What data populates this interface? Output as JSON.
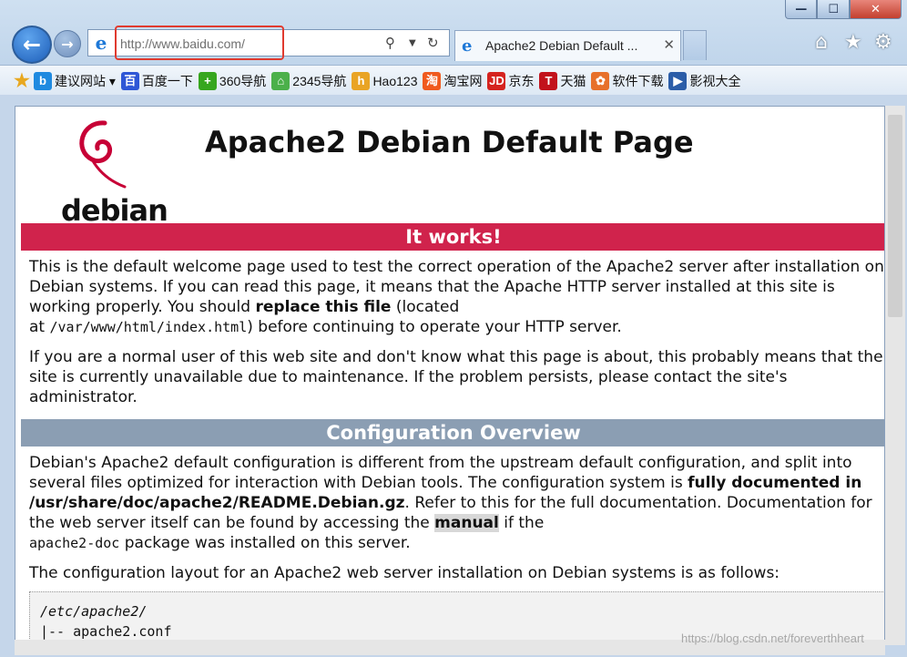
{
  "window": {
    "min": "—",
    "max": "☐",
    "close": "✕"
  },
  "nav": {
    "back": "←",
    "forward": "→"
  },
  "address": {
    "url": "http://www.baidu.com/"
  },
  "tab": {
    "title": "Apache2 Debian Default ..."
  },
  "favorites": [
    {
      "label": "建议网站 ▾",
      "icon": "bing-icon",
      "color": "#1f8ae0",
      "glyph": "b"
    },
    {
      "label": "百度一下",
      "icon": "baidu-paw-icon",
      "color": "#2f57d6",
      "glyph": "百"
    },
    {
      "label": "360导航",
      "icon": "360-icon",
      "color": "#36a61e",
      "glyph": "+"
    },
    {
      "label": "2345导航",
      "icon": "2345-house-icon",
      "color": "#4bb04a",
      "glyph": "⌂"
    },
    {
      "label": "Hao123",
      "icon": "hao123-icon",
      "color": "#e9a425",
      "glyph": "h"
    },
    {
      "label": "淘宝网",
      "icon": "taobao-icon",
      "color": "#f05a1e",
      "glyph": "淘"
    },
    {
      "label": "京东",
      "icon": "jd-icon",
      "color": "#d5231f",
      "glyph": "JD"
    },
    {
      "label": "天猫",
      "icon": "tmall-icon",
      "color": "#c2121c",
      "glyph": "T"
    },
    {
      "label": "软件下载",
      "icon": "software-download-icon",
      "color": "#e7702a",
      "glyph": "✿"
    },
    {
      "label": "影视大全",
      "icon": "video-icon",
      "color": "#2b5da8",
      "glyph": "▶"
    }
  ],
  "page": {
    "logo_text": "debian",
    "title": "Apache2 Debian Default Page",
    "banner1": "It works!",
    "p1a": "This is the default welcome page used to test the correct operation of the Apache2 server after installation on Debian systems. If you can read this page, it means that the Apache HTTP server installed at this site is working properly. You should ",
    "p1b": "replace this file",
    "p1c": " (located",
    "p1d": "at ",
    "p1e": "/var/www/html/index.html",
    "p1f": ") before continuing to operate your HTTP server.",
    "p2": "If you are a normal user of this web site and don't know what this page is about, this probably means that the site is currently unavailable due to maintenance. If the problem persists, please contact the site's administrator.",
    "banner2": "Configuration Overview",
    "p3a": "Debian's Apache2 default configuration is different from the upstream default configuration, and split into several files optimized for interaction with Debian tools. The configuration system is ",
    "p3b": "fully documented in /usr/share/doc/apache2/README.Debian.gz",
    "p3c": ". Refer to this for the full documentation. Documentation for the web server itself can be found by accessing the ",
    "p3d": "manual",
    "p3e": " if the",
    "p3f": "apache2-doc",
    "p3g": " package was installed on this server.",
    "p4": "The configuration layout for an Apache2 web server installation on Debian systems is as follows:",
    "code1": "/etc/apache2/",
    "code2": "|-- apache2.conf"
  },
  "watermark": "https://blog.csdn.net/foreverthheart"
}
